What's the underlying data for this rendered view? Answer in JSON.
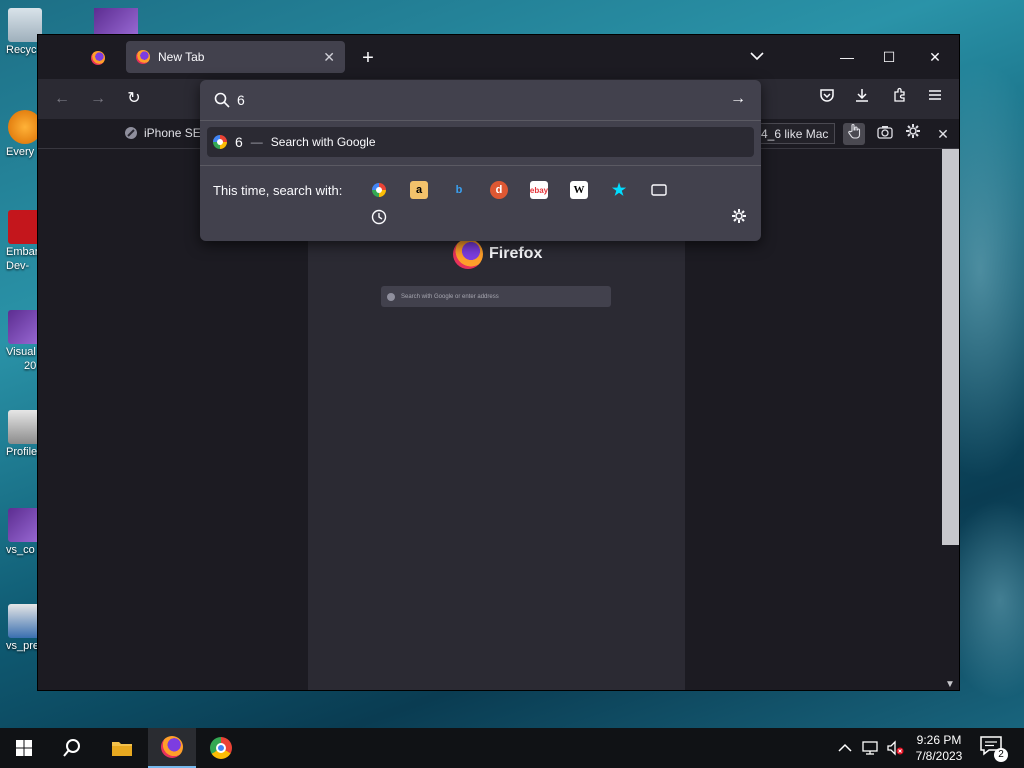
{
  "desktop": {
    "icons": [
      {
        "label": "Recyc"
      },
      {
        "label": "Every"
      },
      {
        "label": "Embar"
      },
      {
        "label": "Dev-"
      },
      {
        "label": "Visual"
      },
      {
        "label": "20"
      },
      {
        "label": "Profile"
      },
      {
        "label": "vs_co"
      },
      {
        "label": "vs_pre"
      }
    ]
  },
  "browser": {
    "tab": {
      "title": "New Tab"
    },
    "rdm": {
      "device": "iPhone SE",
      "user_agent": "4_6 like Mac"
    },
    "viewport": {
      "brand": "Firefox",
      "search_placeholder": "Search with Google or enter address"
    },
    "urlbar": {
      "value": "6",
      "suggestion": {
        "term": "6",
        "separator": "—",
        "action": "Search with Google"
      },
      "one_off_label": "This time, search with:",
      "engines": [
        "google-icon",
        "amazon-icon",
        "bing-icon",
        "duckduckgo-icon",
        "ebay-icon",
        "wikipedia-icon",
        "bookmarks-icon",
        "tabs-icon",
        "history-icon"
      ]
    }
  },
  "taskbar": {
    "time": "9:26 PM",
    "date": "7/8/2023",
    "notifications": "2"
  },
  "colors": {
    "chrome_dark": "#1c1b22",
    "toolbar": "#2b2a33",
    "popup": "#42414d",
    "accent": "#00ddff"
  }
}
